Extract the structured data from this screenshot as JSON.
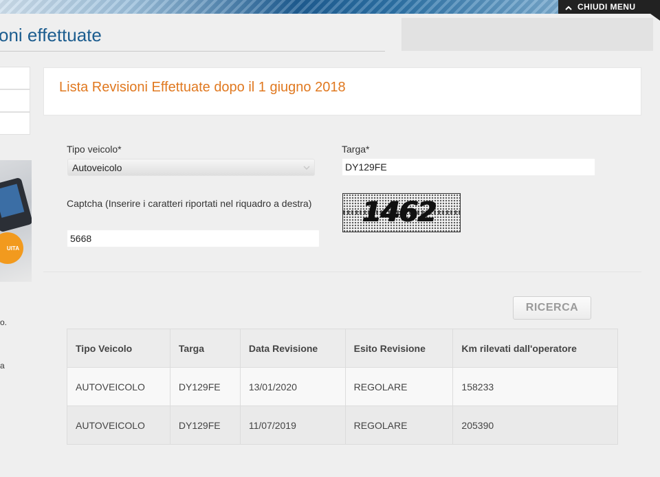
{
  "header": {
    "menu_button_label": "CHIUDI MENU",
    "page_title": "oni effettuate"
  },
  "sidebar": {
    "promo_badge_text": "UITA",
    "text_fragment_1": "o.",
    "text_fragment_2": "a"
  },
  "panel": {
    "title": "Lista Revisioni Effettuate dopo il 1 giugno 2018"
  },
  "form": {
    "tipo_veicolo_label": "Tipo veicolo*",
    "tipo_veicolo_value": "Autoveicolo",
    "targa_label": "Targa*",
    "targa_value": "DY129FE",
    "captcha_label": "Captcha (Inserire i caratteri riportati nel riquadro a destra)",
    "captcha_value": "5668",
    "captcha_image_text": "1462",
    "search_button_label": "RICERCA"
  },
  "table": {
    "headers": [
      "Tipo Veicolo",
      "Targa",
      "Data Revisione",
      "Esito Revisione",
      "Km rilevati dall'operatore"
    ],
    "rows": [
      [
        "AUTOVEICOLO",
        "DY129FE",
        "13/01/2020",
        "REGOLARE",
        "158233"
      ],
      [
        "AUTOVEICOLO",
        "DY129FE",
        "11/07/2019",
        "REGOLARE",
        "205390"
      ]
    ]
  },
  "colors": {
    "title_blue": "#1c5d8f",
    "panel_orange": "#e0781f",
    "menu_bar": "#222222"
  },
  "icons": {
    "menu_button": "chevron-up-icon",
    "select": "chevron-down-icon"
  }
}
